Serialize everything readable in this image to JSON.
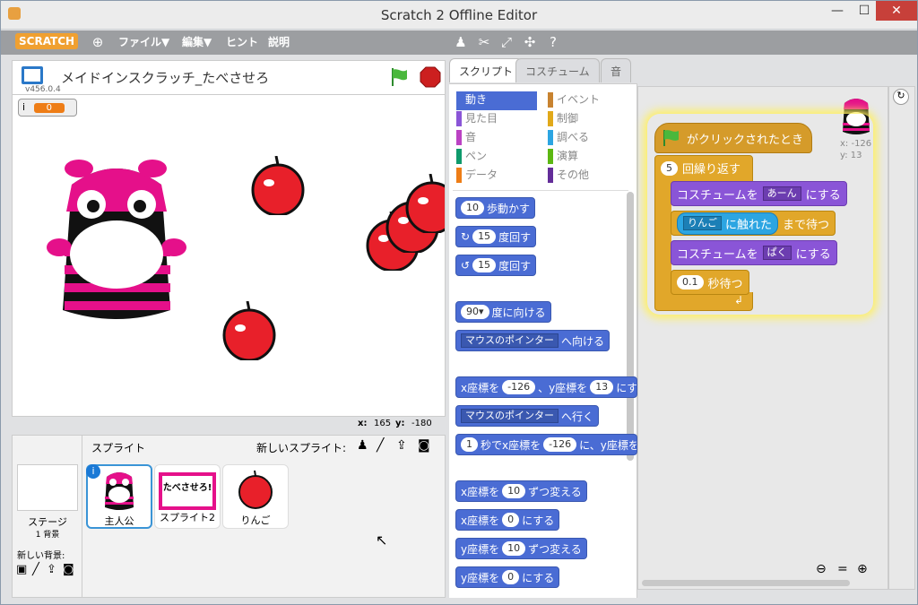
{
  "window": {
    "title": "Scratch 2 Offline Editor",
    "min_icon": "minimize-icon",
    "max_icon": "maximize-icon",
    "close_icon": "close-icon",
    "close": "✕"
  },
  "menubar": {
    "logo": "SCRATCH",
    "file": "ファイル▼",
    "edit": "編集▼",
    "hint": "ヒント",
    "about": "説明"
  },
  "stage": {
    "project_title": "メイドインスクラッチ_たべさせろ",
    "version": "v456.0.4",
    "var_name": "i",
    "var_value": "0",
    "mouse_x_label": "x:",
    "mouse_x": "165",
    "mouse_y_label": "y:",
    "mouse_y": "-180"
  },
  "sprites": {
    "header": "スプライト",
    "new_sprite": "新しいスプライト:",
    "stage_label": "ステージ",
    "stage_bg_count": "1 背景",
    "new_backdrop": "新しい背景:",
    "items": [
      {
        "name": "主人公"
      },
      {
        "name": "スプライト2",
        "card": "たべさせろ!"
      },
      {
        "name": "りんご"
      }
    ]
  },
  "tabs": {
    "script": "スクリプト",
    "costume": "コスチューム",
    "sound": "音"
  },
  "categories": {
    "left": [
      "動き",
      "見た目",
      "音",
      "ペン",
      "データ"
    ],
    "right": [
      "イベント",
      "制御",
      "調べる",
      "演算",
      "その他"
    ]
  },
  "palette": {
    "move": {
      "val": "10",
      "text": "歩動かす"
    },
    "turn_r": {
      "val": "15",
      "text": "度回す"
    },
    "turn_l": {
      "val": "15",
      "text": "度回す"
    },
    "point_dir": {
      "val": "90▾",
      "text": "度に向ける"
    },
    "point_to": {
      "drop": "マウスのポインター",
      "text": "へ向ける"
    },
    "goto_xy": {
      "t1": "x座標を",
      "x": "-126",
      "t2": "、y座標を",
      "y": "13",
      "t3": "にす"
    },
    "goto": {
      "drop": "マウスのポインター",
      "text": "へ行く"
    },
    "glide": {
      "val": "1",
      "t1": "秒でx座標を",
      "x": "-126",
      "t2": "に、y座標を"
    },
    "change_x": {
      "t1": "x座標を",
      "val": "10",
      "t2": "ずつ変える"
    },
    "set_x": {
      "t1": "x座標を",
      "val": "0",
      "t2": "にする"
    },
    "change_y": {
      "t1": "y座標を",
      "val": "10",
      "t2": "ずつ変える"
    },
    "set_y": {
      "t1": "y座標を",
      "val": "0",
      "t2": "にする"
    }
  },
  "script": {
    "hat": "がクリックされたとき",
    "repeat_val": "5",
    "repeat_text": "回繰り返す",
    "costume1_t1": "コスチュームを",
    "costume1_val": "あーん",
    "costume1_t2": "にする",
    "wait_touch_val": "りんご",
    "wait_touch_t1": "に触れた",
    "wait_touch_t2": "まで待つ",
    "costume2_t1": "コスチュームを",
    "costume2_val": "ぱく",
    "costume2_t2": "にする",
    "wait_val": "0.1",
    "wait_text": "秒待つ",
    "sprite_x": "x: -126",
    "sprite_y": "y: 13"
  }
}
